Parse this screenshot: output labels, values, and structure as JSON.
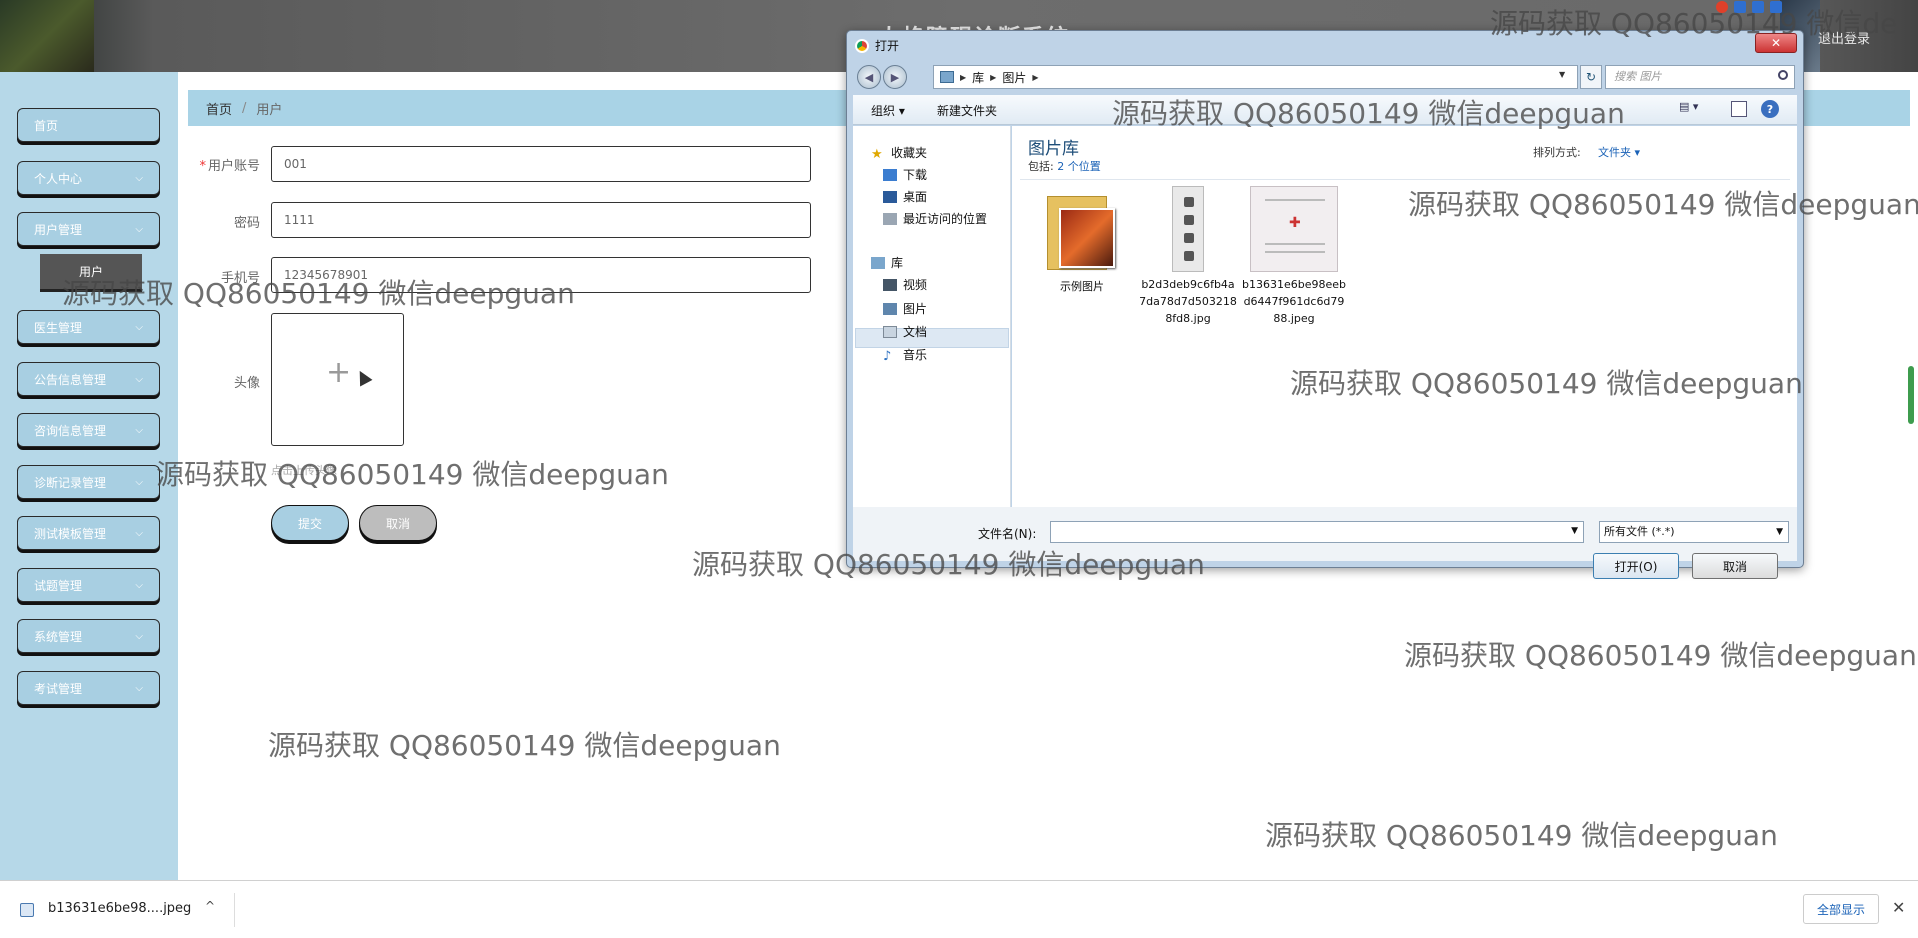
{
  "header": {
    "app_title": "人格障碍诊断系统",
    "logout": "退出登录"
  },
  "sidebar": {
    "items": [
      {
        "label": "首页",
        "chevron": false
      },
      {
        "label": "个人中心",
        "chevron": true
      },
      {
        "label": "用户管理",
        "chevron": true
      },
      {
        "label": "医生管理",
        "chevron": true
      },
      {
        "label": "公告信息管理",
        "chevron": true
      },
      {
        "label": "咨询信息管理",
        "chevron": true
      },
      {
        "label": "诊断记录管理",
        "chevron": true
      },
      {
        "label": "测试模板管理",
        "chevron": true
      },
      {
        "label": "试题管理",
        "chevron": true
      },
      {
        "label": "系统管理",
        "chevron": true
      },
      {
        "label": "考试管理",
        "chevron": true
      }
    ],
    "sub_item": "用户"
  },
  "breadcrumb": {
    "home": "首页",
    "separator": "/",
    "current": "用户"
  },
  "form": {
    "account": {
      "required_mark": "*",
      "label": "用户账号",
      "value": "001"
    },
    "password": {
      "label": "密码",
      "value": "1111"
    },
    "phone": {
      "label": "手机号",
      "value": "12345678901"
    },
    "avatar": {
      "label": "头像",
      "plus": "+",
      "hint": "点击上传头像"
    },
    "submit_label": "提交",
    "cancel_label": "取消"
  },
  "dialog": {
    "title": "打开",
    "close": "✕",
    "address": [
      "库",
      "图片"
    ],
    "search_placeholder": "搜索 图片",
    "toolbar": {
      "organize": "组织 ▾",
      "new_folder": "新建文件夹",
      "help": "?"
    },
    "nav_tree": {
      "favorites": "收藏夹",
      "download": "下载",
      "desktop": "桌面",
      "recent": "最近访问的位置",
      "libraries": "库",
      "videos": "视频",
      "pictures": "图片",
      "documents": "文档",
      "music": "音乐"
    },
    "library_title": "图片库",
    "includes_label": "包括:",
    "includes_link": "2 个位置",
    "sort_label": "排列方式:",
    "sort_value": "文件夹 ▾",
    "files": [
      {
        "name": "示例图片",
        "type": "folder"
      },
      {
        "name": "b2d3deb9c6fb4a7da78d7d5032188fd8.jpg",
        "type": "image"
      },
      {
        "name": "b13631e6be98eebd6447f961dc6d7988.jpeg",
        "type": "image"
      }
    ],
    "filename_label": "文件名(N):",
    "filetype": "所有文件 (*.*)",
    "open_button": "打开(O)",
    "cancel_button": "取消"
  },
  "watermark": "源码获取 QQ86050149 微信deepguan",
  "watermark_partial": "源码获取 QQ86050149 微信de",
  "download_bar": {
    "file_name": "b13631e6be98....jpeg",
    "chevron": "^",
    "show_all": "全部显示",
    "close": "✕"
  },
  "colors": {
    "sidebar_bg": "#b6d8e8",
    "button_blue": "#a8cfe2",
    "breadcrumb_bg": "#a9d3e6"
  }
}
